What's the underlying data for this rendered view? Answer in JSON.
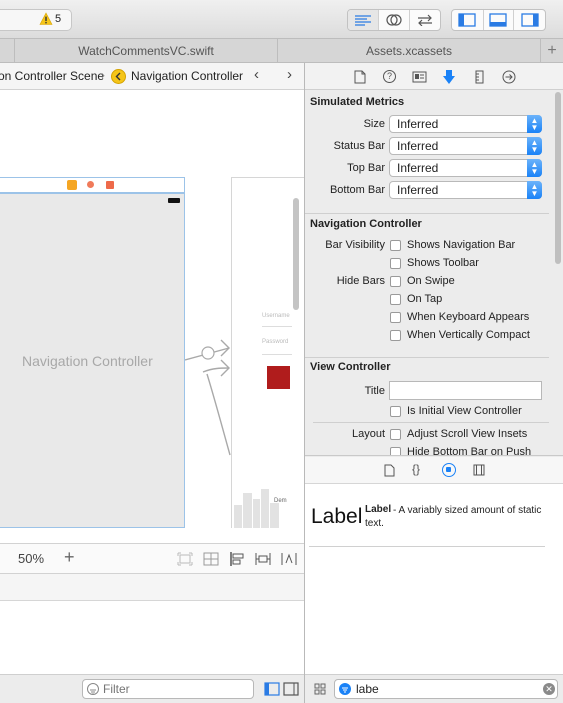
{
  "toolbar": {
    "warning_count": "5",
    "editor_modes": [
      "standard-editor",
      "assistant-editor",
      "version-editor"
    ],
    "panel_toggles": [
      "navigator",
      "debug-area",
      "utilities"
    ]
  },
  "tabs": [
    {
      "label": "WatchCommentsVC.swift"
    },
    {
      "label": "Assets.xcassets"
    }
  ],
  "jumpbar": {
    "crumb_scene": "on Controller Scene",
    "crumb_current": "Navigation Controller"
  },
  "canvas": {
    "scene_label": "Navigation Controller",
    "zoom": "50%",
    "side_text_1": "Username",
    "side_text_2": "Password",
    "side_text_3": "Dem"
  },
  "navigator_filter": {
    "placeholder": "Filter"
  },
  "inspector": {
    "simulated_metrics": {
      "title": "Simulated Metrics",
      "rows": [
        {
          "label": "Size",
          "value": "Inferred"
        },
        {
          "label": "Status Bar",
          "value": "Inferred"
        },
        {
          "label": "Top Bar",
          "value": "Inferred"
        },
        {
          "label": "Bottom Bar",
          "value": "Inferred"
        }
      ]
    },
    "navigation_controller": {
      "title": "Navigation Controller",
      "bar_visibility_label": "Bar Visibility",
      "hide_bars_label": "Hide Bars",
      "options": [
        {
          "label": "Shows Navigation Bar",
          "checked": false
        },
        {
          "label": "Shows Toolbar",
          "checked": false
        },
        {
          "label": "On Swipe",
          "checked": false
        },
        {
          "label": "On Tap",
          "checked": false
        },
        {
          "label": "When Keyboard Appears",
          "checked": false
        },
        {
          "label": "When Vertically Compact",
          "checked": false
        }
      ]
    },
    "view_controller": {
      "title": "View Controller",
      "title_label": "Title",
      "title_value": "",
      "initial_label": "Is Initial View Controller",
      "layout_label": "Layout",
      "adjust_scroll": "Adjust Scroll View Insets",
      "hide_bottom": "Hide Bottom Bar on Push"
    }
  },
  "library": {
    "item_name": "Label",
    "item_icon_text": "Label",
    "item_desc": "- A variably sized amount of static text.",
    "search_value": "labe"
  },
  "colors": {
    "accent": "#1a82f7",
    "warning": "#f5c518",
    "segue_red": "#b01c1c"
  }
}
